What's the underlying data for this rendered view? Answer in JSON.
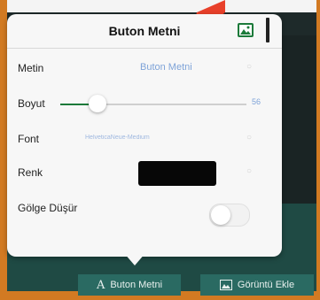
{
  "popover": {
    "title": "Buton Metni"
  },
  "rows": {
    "text": {
      "label": "Metin",
      "value": "Buton Metni"
    },
    "size": {
      "label": "Boyut",
      "value": "56",
      "slider_level": 0.2
    },
    "font": {
      "label": "Font",
      "value": "HelveticaNeue-Medium"
    },
    "color": {
      "label": "Renk",
      "swatch": "#070707"
    },
    "shadow": {
      "label": "Gölge Düşür",
      "on": false
    }
  },
  "toolbar": {
    "text_button": {
      "glyph": "A",
      "label": "Buton Metni"
    },
    "image_button": {
      "label": "Görüntü Ekle"
    }
  },
  "colors": {
    "accent_green": "#1c7a3a",
    "link_blue": "#7ea3d8",
    "toolbar_teal": "#2a6a62",
    "arrow_red": "#e8402a"
  }
}
